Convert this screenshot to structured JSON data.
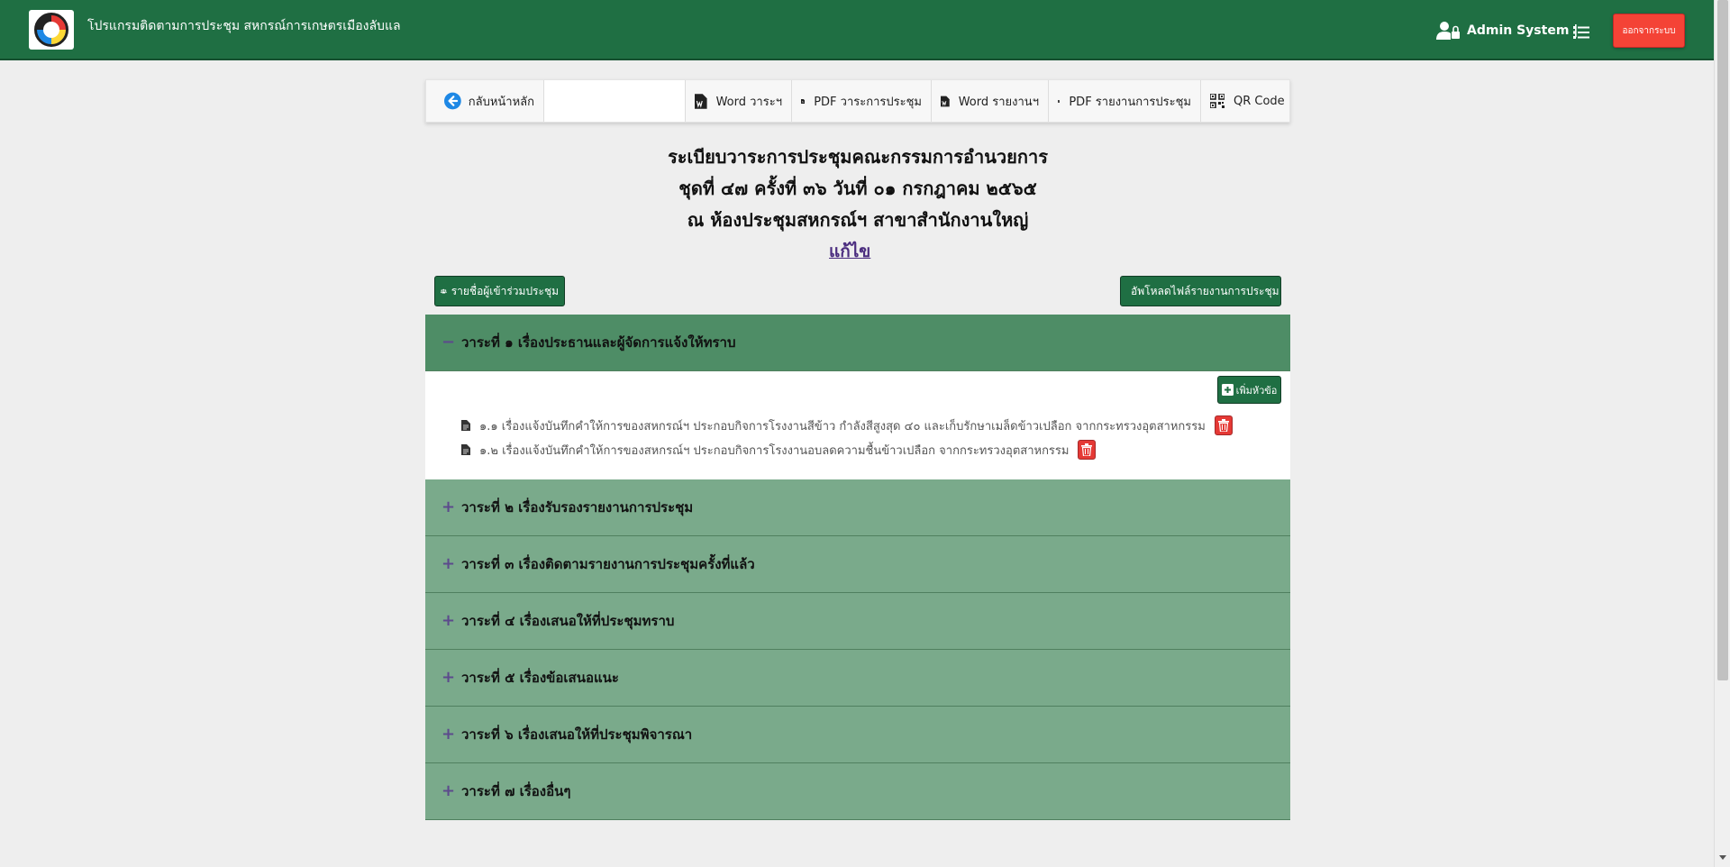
{
  "navbar": {
    "app_title": "โปรแกรมติดตามการประชุม สหกรณ์การเกษตรเมืองลับแล",
    "user_name": "Admin System |",
    "logout_label": "ออกจากระบบ",
    "brand_color": "#1f6f43",
    "logout_color": "#f44336"
  },
  "toolbar": {
    "back_label": "กลับหน้าหลัก",
    "search_value": "",
    "word_agenda_label": "Word วาระฯ",
    "pdf_agenda_label": "PDF วาระการประชุม",
    "word_report_label": "Word รายงานฯ",
    "pdf_report_label": "PDF รายงานการประชุม",
    "qr_label": "QR Code"
  },
  "heading": {
    "line1": "ระเบียบวาระการประชุมคณะกรรมการอำนวยการ",
    "line2": "ชุดที่ ๔๗ ครั้งที่ ๓๖  วันที่ ๐๑ กรกฎาคม ๒๕๖๕",
    "line3": "ณ ห้องประชุมสหกรณ์ฯ สาขาสำนักงานใหญ่",
    "edit_label": "แก้ไข"
  },
  "actions": {
    "attendees_label": "รายชื่อผู้เข้าร่วมประชุม",
    "upload_label": "อัพโหลดไฟล์รายงานการประชุม"
  },
  "agenda": {
    "add_topic_label": "เพิ่มหัวข้อ",
    "items": [
      {
        "label": "วาระที่ ๑ เรื่องประธานและผู้จัดการแจ้งให้ทราบ",
        "toggle": "−",
        "open": true
      },
      {
        "label": "วาระที่ ๒ เรื่องรับรองรายงานการประชุม",
        "toggle": "+",
        "open": false
      },
      {
        "label": "วาระที่ ๓ เรื่องติดตามรายงานการประชุมครั้งที่แล้ว",
        "toggle": "+",
        "open": false
      },
      {
        "label": "วาระที่ ๔ เรื่องเสนอให้ที่ประชุมทราบ",
        "toggle": "+",
        "open": false
      },
      {
        "label": "วาระที่ ๕ เรื่องข้อเสนอแนะ",
        "toggle": "+",
        "open": false
      },
      {
        "label": "วาระที่ ๖ เรื่องเสนอให้ที่ประชุมพิจารณา",
        "toggle": "+",
        "open": false
      },
      {
        "label": "วาระที่ ๗ เรื่องอื่นๆ",
        "toggle": "+",
        "open": false
      }
    ],
    "sub_items": [
      {
        "label": "๑.๑ เรื่องแจ้งบันทึกคำให้การของสหกรณ์ฯ ประกอบกิจการโรงงานสีข้าว กำลังสีสูงสุด ๔๐ และเก็บรักษาเมล็ดข้าวเปลือก จากกระทรวงอุตสาหกรรม"
      },
      {
        "label": "๑.๒ เรื่องแจ้งบันทึกคำให้การของสหกรณ์ฯ ประกอบกิจการโรงงานอบลดความชื้นข้าวเปลือก จากกระทรวงอุตสาหกรรม"
      }
    ],
    "header_color": "#7aaa8b",
    "open_header_color": "#4e8d66",
    "delete_color": "#e53935"
  }
}
